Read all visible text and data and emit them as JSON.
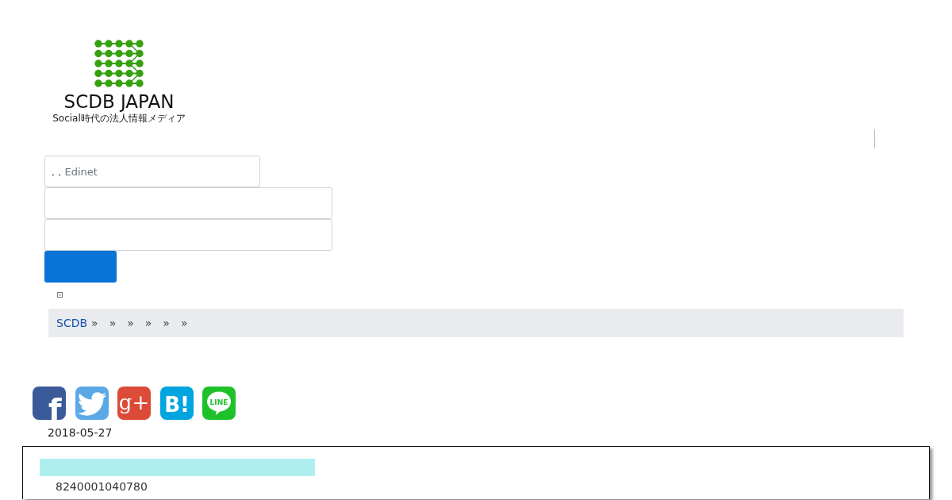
{
  "logo": {
    "title": "SCDB JAPAN",
    "tagline": "Social時代の法人情報メディア"
  },
  "search": {
    "fields": [
      {
        "kind": "short",
        "placeholder": ", , Edinet"
      },
      {
        "kind": "long"
      },
      {
        "kind": "long"
      }
    ]
  },
  "breadcrumb": {
    "home": "SCDB",
    "separators": [
      "»",
      "»",
      "»",
      "»",
      "»",
      "»"
    ]
  },
  "share_buttons": [
    {
      "kind": "facebook",
      "glyph": "f"
    },
    {
      "kind": "twitter"
    },
    {
      "kind": "googleplus",
      "glyph": "g+"
    },
    {
      "kind": "hatena",
      "glyph": "B!"
    },
    {
      "kind": "line",
      "glyph": "LINE"
    }
  ],
  "date": "2018-05-27",
  "record": {
    "number": "8240001040780"
  }
}
